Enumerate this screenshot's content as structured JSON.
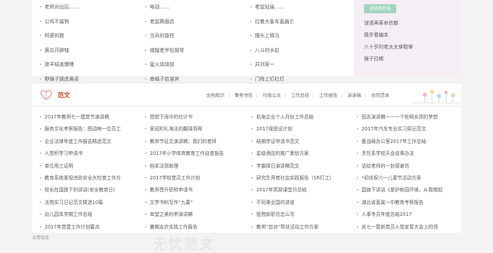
{
  "top_list": {
    "col1": [
      "老师对出后……",
      "公鸡不属狗",
      "阿婆的鞋",
      "黄瓜开辟辖",
      "旅羊结盖慷佛",
      "野猴子跳虎鼻梁"
    ],
    "col2": [
      "电动……",
      "老鼠爬面店",
      "当兵的旋柱",
      "城隍老爷包胡琴",
      "猛火烧烧烧",
      "串绳子拾准斧"
    ],
    "col3": [
      "老鼠钻庙……",
      "拉着大象车直扁仑",
      "撞头上晴马",
      "八斗的水缸",
      "井刘家一",
      "门阵上钉红灯"
    ]
  },
  "right_panel": {
    "tag": "谜语歇后语",
    "items": [
      "谜语再革命信都",
      "猜岁看编本",
      "八十岁的老太太穿鞋掌",
      "猴子拉稀"
    ]
  },
  "section": {
    "title": "范文",
    "tabs": [
      "文档知识",
      "事务书信",
      "行政公文",
      "工作总结",
      "工作报告",
      "演讲稿",
      "合同范本"
    ]
  },
  "articles": {
    "col1": [
      "2017年教师七一建党节演讲稿",
      "服务文化考察报告：图动梅一位员工",
      "企业法律年度工作报告精选范文",
      "人党积学习申请书",
      "单位用工证明",
      "教育系统重视违防安全大检查工作方",
      "校长在国旗下的讲话(安全教育日)",
      "法院实习日记范文精选10篇",
      "幼儿园本学期工作总结",
      "2017年党建工作计划要点"
    ],
    "col2": [
      "想想下雨中的社计书",
      "家冠的礼海法的翻译到得",
      "教师节征文演讲稿：我们的老师",
      "2017年小学体育教育工作自查报告",
      "档本法到助理",
      "2017学校党员工作计划",
      "教师晋升职称申请书",
      "文学书料写作“九要”",
      "幸望之美的申演讲稿",
      "暑期支农实践工作报告"
    ],
    "col3": [
      "机电企业个人月份工作总结",
      "2017规团设计划",
      "结期学证申请书范文",
      "星级酒店的推广策划方案",
      "学霸择日演讲稿范文",
      "研究生界者社会实践报告（SR打工）",
      "2017年高财课堂月总结",
      "不同事业国的讲道",
      "医院新职信怎么写",
      "教师“忽对”帮扶活动工作方案"
    ],
    "col4": [
      "固志演讲稿——一个轮椅女孩的梦想",
      "2017年汽车专业实习周记范文",
      "备战局办公室2017年工作总结",
      "烹饪系学校天会说事办法",
      "话给老师的一封感谢信",
      "*初庆祝六一儿童节活动方案",
      "国旗下讲话《爱护和园环境，从我做起",
      "湖北省直属一中教育考察报告",
      "人事专员年度总结2017",
      "庆七一暨新党员入党宣誓大会上的领"
    ]
  },
  "footer": {
    "note": "友情链接",
    "watermark": "无忧范文"
  }
}
